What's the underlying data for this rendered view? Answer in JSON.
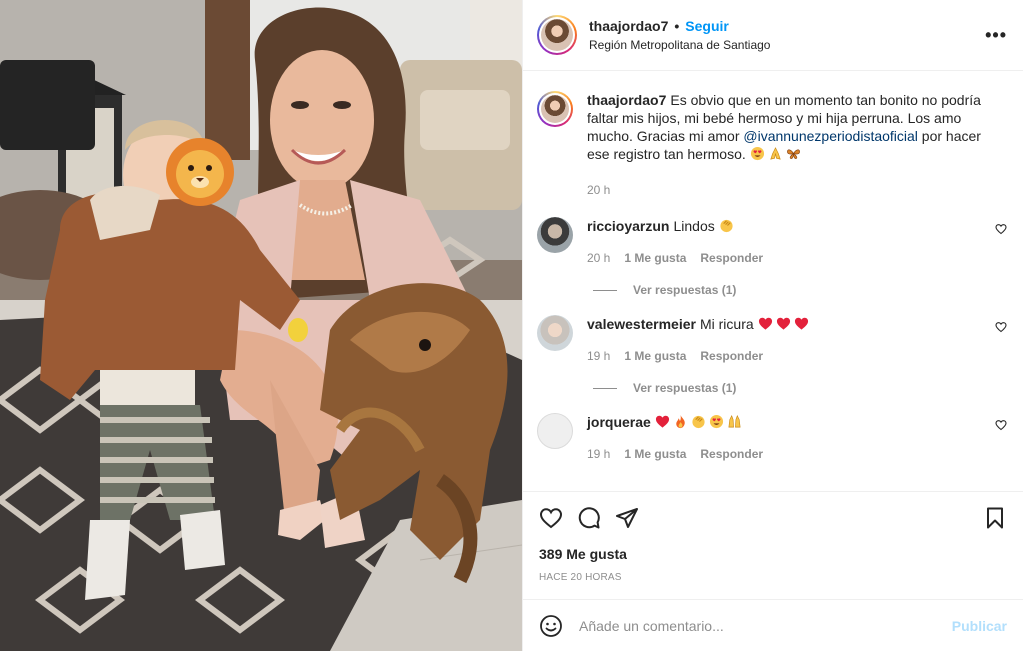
{
  "post": {
    "username": "thaajordao7",
    "dot": "•",
    "follow_label": "Seguir",
    "location": "Región Metropolitana de Santiago",
    "more_label": "•••"
  },
  "caption": {
    "username": "thaajordao7",
    "text_before": "Es obvio que en un momento tan bonito no podría faltar mis hijos, mi bebé hermoso y mi hija perruna. Los amo mucho. Gracias mi amor ",
    "mention": "@ivannunezperiodistaoficial",
    "text_after": " por hacer ese registro tan hermoso. ",
    "emojis": [
      "heart-eyes-emoji",
      "praying-hands-emoji",
      "butterfly-emoji"
    ],
    "time": "20 h"
  },
  "comments": [
    {
      "username": "riccioyarzun",
      "text": "Lindos",
      "emojis": [
        "clapping-hands-emoji"
      ],
      "time": "20 h",
      "likes": "1 Me gusta",
      "reply_label": "Responder",
      "view_replies": "Ver respuestas (1)"
    },
    {
      "username": "valewestermeier",
      "text": "Mi ricura",
      "emojis": [
        "red-heart-emoji",
        "red-heart-emoji",
        "red-heart-emoji"
      ],
      "time": "19 h",
      "likes": "1 Me gusta",
      "reply_label": "Responder",
      "view_replies": "Ver respuestas (1)"
    },
    {
      "username": "jorquerae",
      "text": "",
      "emojis": [
        "red-heart-emoji",
        "fire-emoji",
        "clapping-hands-emoji",
        "heart-eyes-emoji",
        "praising-hands-emoji"
      ],
      "time": "19 h",
      "likes": "1 Me gusta",
      "reply_label": "Responder"
    }
  ],
  "actions": {
    "likes": "389 Me gusta",
    "time_ago": "HACE 20 HORAS"
  },
  "add_comment": {
    "placeholder": "Añade un comentario...",
    "publish_label": "Publicar"
  },
  "colors": {
    "link_blue": "#0095f6",
    "publish_disabled": "#b2dffc",
    "muted_text": "#8e8e8e",
    "text": "#262626",
    "heart_red": "#e0245e"
  }
}
